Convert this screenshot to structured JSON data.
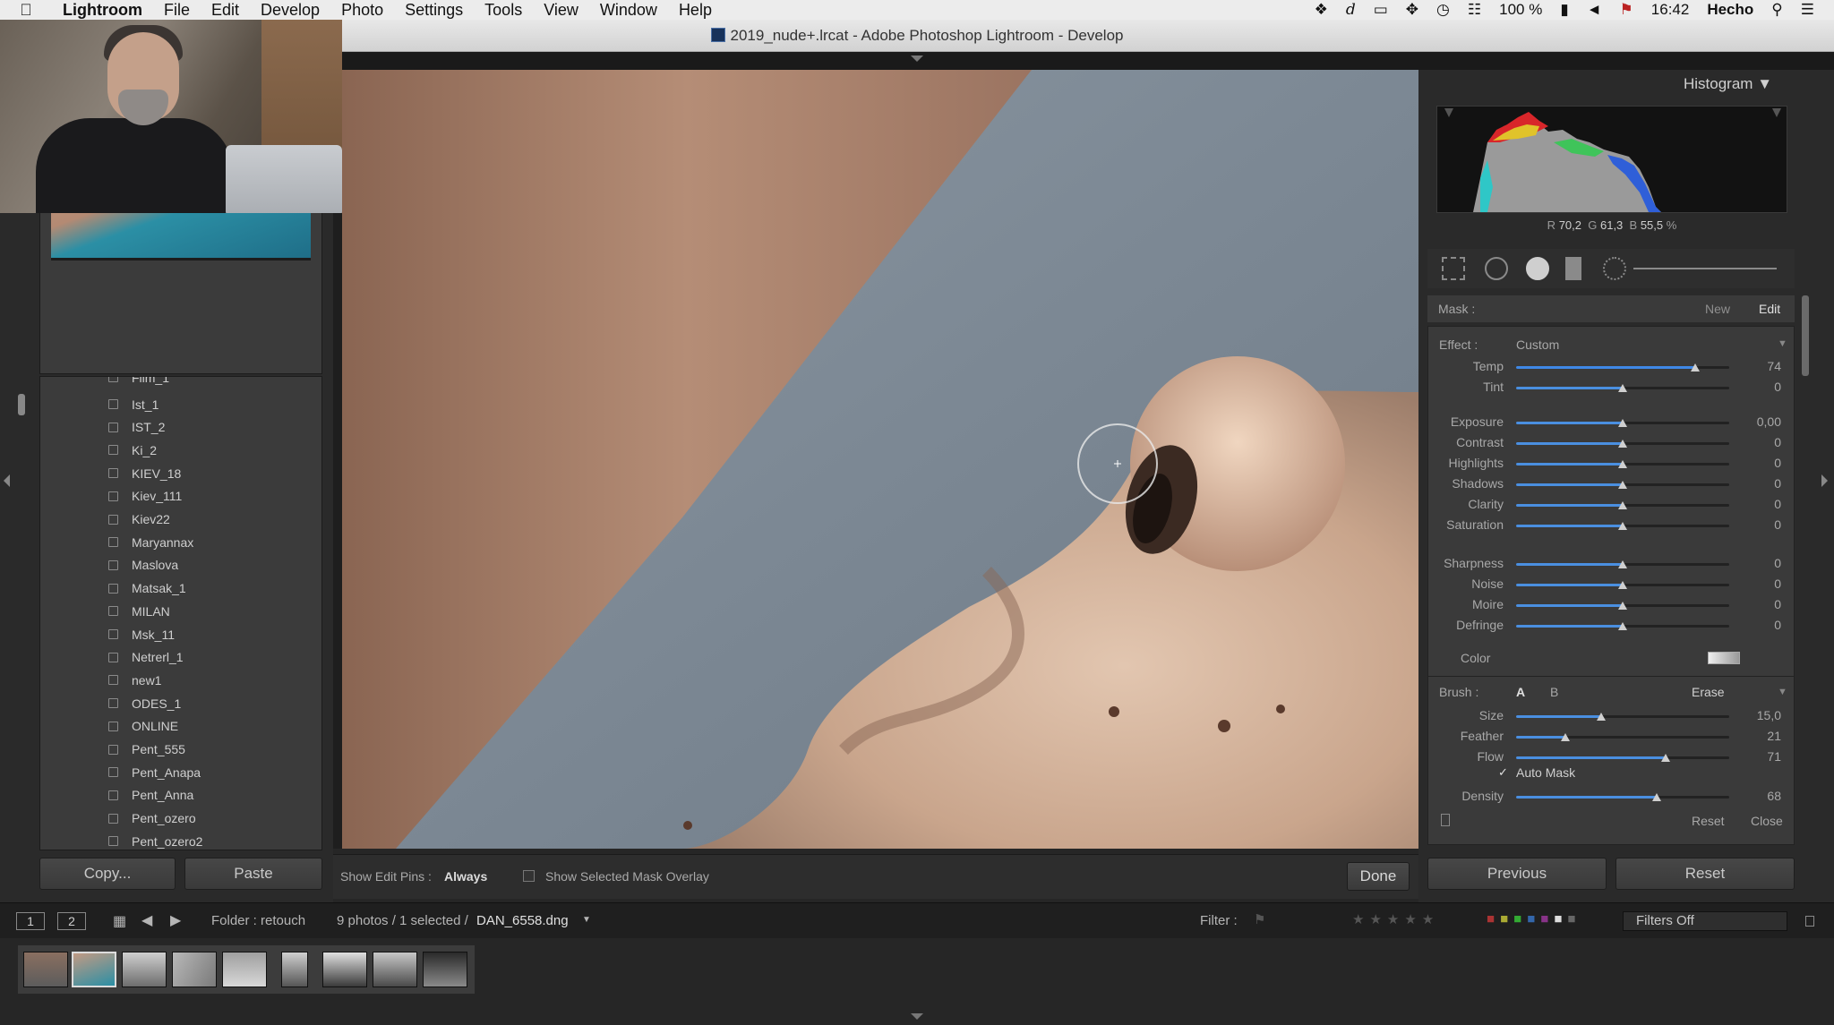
{
  "menubar": {
    "apple": "",
    "items": [
      "Lightroom",
      "File",
      "Edit",
      "Develop",
      "Photo",
      "Settings",
      "Tools",
      "View",
      "Window",
      "Help"
    ],
    "battery": "100 %",
    "time": "16:42",
    "user": "Hecho"
  },
  "window": {
    "title": "2019_nude+.lrcat - Adobe Photoshop Lightroom - Develop"
  },
  "collections": [
    "Ist_1",
    "IST_2",
    "Ki_2",
    "KIEV_18",
    "Kiev_111",
    "Kiev22",
    "Maryannax",
    "Maslova",
    "Matsak_1",
    "MILAN",
    "Msk_11",
    "Netrerl_1",
    "new1",
    "ODES_1",
    "ONLINE",
    "Pent_555",
    "Pent_Anapa",
    "Pent_Anna",
    "Pent_ozero",
    "Pent_ozero2"
  ],
  "collections_partial_top": "Film_1",
  "left_buttons": {
    "copy": "Copy...",
    "paste": "Paste"
  },
  "toolbar": {
    "pins_label": "Show Edit Pins :",
    "pins_value": "Always",
    "overlay_label": "Show Selected Mask Overlay",
    "done": "Done"
  },
  "histogram": {
    "title": "Histogram",
    "r_label": "R",
    "r": "70,2",
    "g_label": "G",
    "g": "61,3",
    "b_label": "B",
    "b": "55,5",
    "unit": "%"
  },
  "mask": {
    "label": "Mask :",
    "new": "New",
    "edit": "Edit"
  },
  "effect": {
    "label": "Effect :",
    "preset": "Custom"
  },
  "sliders_a": [
    {
      "label": "Temp",
      "value": "74",
      "level": 0.84
    },
    {
      "label": "Tint",
      "value": "0",
      "level": 0.5
    }
  ],
  "sliders_b": [
    {
      "label": "Exposure",
      "value": "0,00",
      "level": 0.5
    },
    {
      "label": "Contrast",
      "value": "0",
      "level": 0.5
    },
    {
      "label": "Highlights",
      "value": "0",
      "level": 0.5
    },
    {
      "label": "Shadows",
      "value": "0",
      "level": 0.5
    },
    {
      "label": "Clarity",
      "value": "0",
      "level": 0.5
    },
    {
      "label": "Saturation",
      "value": "0",
      "level": 0.5
    }
  ],
  "sliders_c": [
    {
      "label": "Sharpness",
      "value": "0",
      "level": 0.5
    },
    {
      "label": "Noise",
      "value": "0",
      "level": 0.5
    },
    {
      "label": "Moire",
      "value": "0",
      "level": 0.5
    },
    {
      "label": "Defringe",
      "value": "0",
      "level": 0.5
    }
  ],
  "color_label": "Color",
  "brush": {
    "label": "Brush :",
    "a": "A",
    "b": "B",
    "erase": "Erase"
  },
  "brush_sliders": [
    {
      "label": "Size",
      "value": "15,0",
      "level": 0.4
    },
    {
      "label": "Feather",
      "value": "21",
      "level": 0.23
    },
    {
      "label": "Flow",
      "value": "71",
      "level": 0.7
    }
  ],
  "automask": {
    "label": "Auto Mask",
    "checked": true
  },
  "density": {
    "label": "Density",
    "value": "68",
    "level": 0.66
  },
  "panel_footer": {
    "reset": "Reset",
    "close": "Close"
  },
  "right_buttons": {
    "previous": "Previous",
    "reset": "Reset"
  },
  "filmbar": {
    "page1": "1",
    "page2": "2",
    "folder": "Folder : retouch",
    "count": "9 photos / 1 selected /",
    "filename": "DAN_6558.dng",
    "filter_label": "Filter :",
    "filters_off": "Filters Off"
  },
  "colors": {
    "accent": "#4a8fe0",
    "temp_fill": "#3f88e6",
    "panel": "#3a3a3a"
  }
}
